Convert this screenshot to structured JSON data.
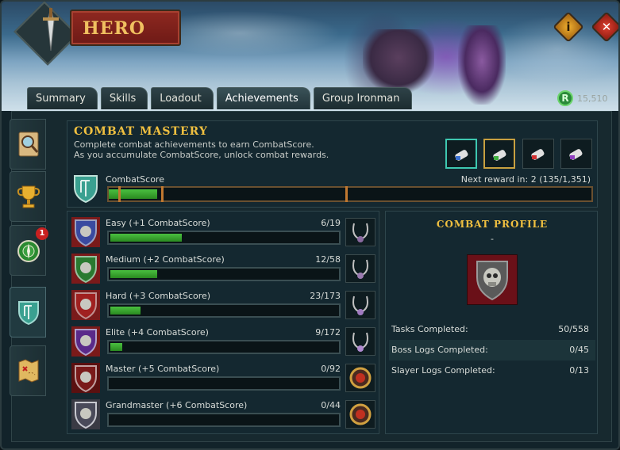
{
  "window": {
    "title": "HERO",
    "info_button": "i",
    "close_button": "✕",
    "coins_icon": "R",
    "coins": "15,510"
  },
  "tabs": [
    {
      "label": "Summary"
    },
    {
      "label": "Skills"
    },
    {
      "label": "Loadout"
    },
    {
      "label": "Achievements",
      "active": true
    },
    {
      "label": "Group Ironman"
    }
  ],
  "side_tabs": [
    {
      "icon": "magnifier-scroll-icon"
    },
    {
      "icon": "trophy-icon"
    },
    {
      "icon": "compass-icon",
      "badge": "1"
    },
    {
      "icon": "combat-shield-icon",
      "active": true
    },
    {
      "icon": "treasure-map-icon"
    }
  ],
  "mastery": {
    "title": "COMBAT MASTERY",
    "desc_line1": "Complete combat achievements to earn CombatScore.",
    "desc_line2": "As you accumulate CombatScore, unlock combat rewards.",
    "score_label": "CombatScore",
    "next_reward": "Next reward in: 2 (135/1,351)",
    "score_progress": 0.1,
    "rewards": [
      {
        "icon": "scroll-blue-icon",
        "ribbon": "#3a70d0"
      },
      {
        "icon": "scroll-green-icon",
        "ribbon": "#40b040"
      },
      {
        "icon": "scroll-red-icon",
        "ribbon": "#d03030"
      },
      {
        "icon": "scroll-purple-icon",
        "ribbon": "#9040c0"
      }
    ]
  },
  "tiers": [
    {
      "label": "Easy (+1 CombatScore)",
      "count": "6/19",
      "progress": 0.316,
      "color": "#3a4aa0"
    },
    {
      "label": "Medium (+2 CombatScore)",
      "count": "12/58",
      "progress": 0.207,
      "color": "#2a7a30"
    },
    {
      "label": "Hard (+3 CombatScore)",
      "count": "23/173",
      "progress": 0.133,
      "color": "#a02020"
    },
    {
      "label": "Elite (+4 CombatScore)",
      "count": "9/172",
      "progress": 0.052,
      "color": "#5a2a8a"
    },
    {
      "label": "Master (+5 CombatScore)",
      "count": "0/92",
      "progress": 0,
      "color": "#7a1a1a"
    },
    {
      "label": "Grandmaster (+6 CombatScore)",
      "count": "0/44",
      "progress": 0,
      "color": "#4a4a5a"
    }
  ],
  "profile": {
    "title": "COMBAT PROFILE",
    "subtitle": "-",
    "stats": [
      {
        "label": "Tasks Completed:",
        "value": "50/558"
      },
      {
        "label": "Boss Logs Completed:",
        "value": "0/45"
      },
      {
        "label": "Slayer Logs Completed:",
        "value": "0/13"
      }
    ]
  }
}
